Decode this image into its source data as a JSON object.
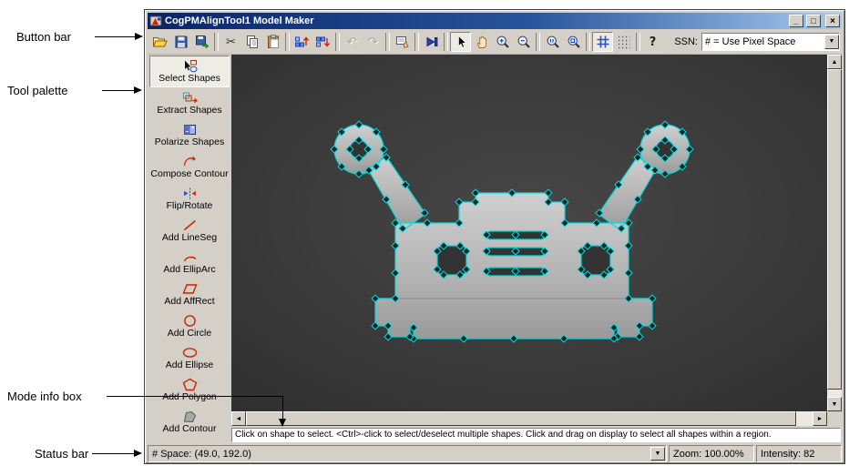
{
  "annotations": {
    "button_bar": "Button bar",
    "tool_palette": "Tool palette",
    "mode_info_box": "Mode info box",
    "status_bar": "Status bar"
  },
  "window": {
    "title": "CogPMAlignTool1 Model Maker"
  },
  "icons": {
    "cut": "✂",
    "undo": "↶",
    "redo": "↷",
    "help": "?",
    "minimize": "_",
    "maximize": "□",
    "close": "×",
    "up": "▲",
    "down": "▼",
    "left": "◄",
    "right": "►"
  },
  "toolbar": {
    "button_names": [
      "open",
      "save",
      "export",
      "cut",
      "copy",
      "paste",
      "raise-shapes",
      "lower-shapes",
      "undo",
      "redo",
      "properties",
      "run",
      "select-pointer",
      "pan",
      "zoom-in",
      "zoom-out",
      "zoom-actual",
      "zoom-fit",
      "grid-axes",
      "grid-points",
      "help"
    ],
    "ssn_label": "SSN:",
    "ssn_value": "# = Use Pixel Space"
  },
  "palette": {
    "items": [
      "Select Shapes",
      "Extract Shapes",
      "Polarize Shapes",
      "Compose Contour",
      "Flip/Rotate",
      "Add LineSeg",
      "Add EllipArc",
      "Add AffRect",
      "Add Circle",
      "Add Ellipse",
      "Add Polygon",
      "Add Contour"
    ]
  },
  "mode_info": "Click on shape to select. <Ctrl>-click to select/deselect multiple shapes. Click and drag on display to select all shapes within a region.",
  "status": {
    "space": "# Space:  (49.0, 192.0)",
    "zoom": "Zoom:  100.00%",
    "intensity": "Intensity: 82"
  },
  "colors": {
    "overlay": "#00dede",
    "chrome": "#d4d0c8",
    "titlebar_left": "#0a246a",
    "titlebar_right": "#a6caf0"
  }
}
